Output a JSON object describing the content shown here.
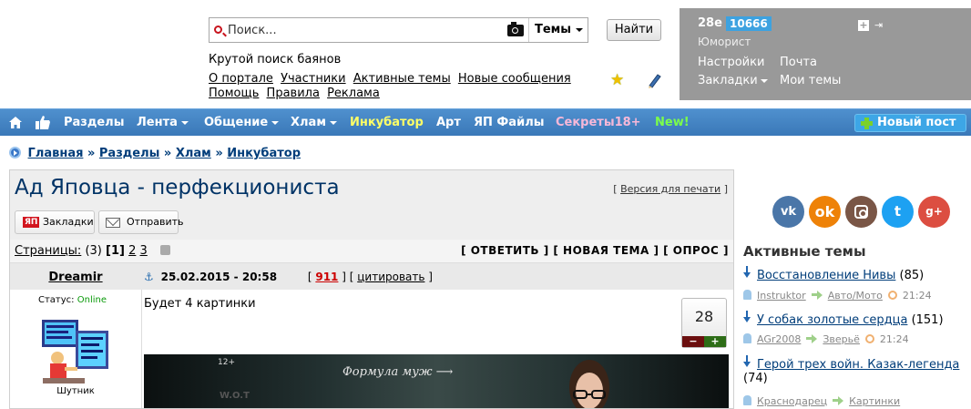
{
  "search": {
    "placeholder": "Поиск...",
    "scope": "Темы",
    "button": "Найти",
    "tagline": "Крутой поиск баянов"
  },
  "header_links": {
    "row1": [
      "О портале",
      "Участники",
      "Активные темы",
      "Новые сообщения"
    ],
    "row2": [
      "Помощь",
      "Правила",
      "Реклама"
    ]
  },
  "user_panel": {
    "name": "28e",
    "rating": "10666",
    "title": "Юморист",
    "settings": "Настройки",
    "mail": "Почта",
    "bookmarks": "Закладки",
    "my_topics": "Мои темы"
  },
  "nav": {
    "items": [
      "Разделы",
      "Лента",
      "Общение",
      "Хлам",
      "Инкубатор",
      "Арт",
      "ЯП Файлы",
      "Секреты18+",
      "New!"
    ],
    "new_post": "Новый пост",
    "colors": {
      "bar": "#3f80c0",
      "incubator": "#ffff66",
      "secrets": "#f7b8d8",
      "new": "#7cff4a"
    }
  },
  "breadcrumb": [
    "Главная",
    "Разделы",
    "Хлам",
    "Инкубатор"
  ],
  "breadcrumb_sep": "»",
  "topic": {
    "title": "Ад Яповца - перфекциониста",
    "print_link": "Версия для печати",
    "bookmarks_btn": "Закладки",
    "send_btn": "Отправить",
    "pages_label": "Страницы:",
    "pages_count": "(3)",
    "current_page": "[1]",
    "other_pages": [
      "2",
      "3"
    ],
    "actions": [
      "ОТВЕТИТЬ",
      "НОВАЯ ТЕМА",
      "ОПРОС"
    ]
  },
  "post": {
    "author": "Dreamir",
    "status_label": "Статус:",
    "status_value": "Online",
    "rank": "Шутник",
    "date": "25.02.2015 - 20:58",
    "number": "911",
    "quote": "цитировать",
    "text": "Будет 4 картинки",
    "votes": "28",
    "image_badge": "12+",
    "image_text": "Формула муж"
  },
  "active_topics": {
    "title": "Активные темы",
    "threads": [
      {
        "title": "Восстановление Нивы",
        "count": "(85)",
        "user": "Instruktor",
        "section": "Авто/Мото",
        "time": "21:24"
      },
      {
        "title": "У собак золотые сердца",
        "count": "(151)",
        "user": "AGr2008",
        "section": "Зверьё",
        "time": "21:24"
      },
      {
        "title": "Герой трех войн. Казак-легенда",
        "count": "(74)",
        "user": "Краснодарец",
        "section": "Картинки",
        "time": ""
      }
    ]
  },
  "social": [
    "vk-icon",
    "odnoklassniki-icon",
    "instagram-icon",
    "twitter-icon",
    "google-plus-icon"
  ]
}
